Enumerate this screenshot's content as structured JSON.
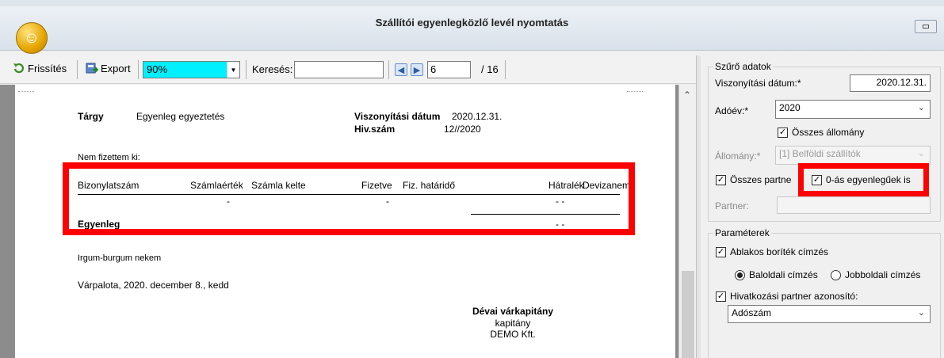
{
  "window": {
    "title": "Szállítói egyenlegközlő levél nyomtatás"
  },
  "toolbar": {
    "refresh_label": "Frissítés",
    "export_label": "Export",
    "zoom_value": "90%",
    "search_label": "Keresés:",
    "search_value": "",
    "page_value": "6",
    "page_total": "/ 16"
  },
  "report": {
    "subject_label": "Tárgy",
    "subject_value": "Egyenleg egyeztetés",
    "date_label": "Viszonyítási dátum",
    "date_value": "2020.12.31.",
    "ref_label": "Hiv.szám",
    "ref_value": "12//2020",
    "unpaid_text": "Nem fizettem ki:",
    "columns": [
      "Bizonylatszám",
      "Számlaérték",
      "Számla kelte",
      "Fizetve",
      "Fiz. határidő",
      "Hátralék",
      "Devizanem"
    ],
    "row_dash_1": "-",
    "row_dash_2": "-",
    "row_dash_3": "-  -",
    "balance_label": "Egyenleg",
    "balance_value": "-  -",
    "note": "Irgum-burgum nekem",
    "place_date": "Várpalota, 2020. december 8., kedd",
    "signer_name": "Dévai várkapitány",
    "signer_title": "kapitány",
    "signer_company": "DEMO Kft."
  },
  "filter": {
    "group_title": "Szűrő adatok",
    "ref_date_label": "Viszonyítási dátum:*",
    "ref_date_value": "2020.12.31.",
    "tax_year_label": "Adóév:*",
    "tax_year_value": "2020",
    "all_stock_label": "Összes állomány",
    "stock_label": "Állomány:*",
    "stock_value": "[1] Belföldi szállítók",
    "all_partner_label": "Összes partne",
    "zero_balance_label": "0-ás egyenlegűek is",
    "partner_label": "Partner:",
    "partner_value": ""
  },
  "params": {
    "group_title": "Paraméterek",
    "window_envelope_label": "Ablakos boríték címzés",
    "left_address_label": "Baloldali címzés",
    "right_address_label": "Jobboldali címzés",
    "ref_partner_id_label": "Hivatkozási partner azonosító:",
    "ref_partner_id_value": "Adószám"
  },
  "colors": {
    "highlight": "#ff0000",
    "zoom_bg": "#00f0ff",
    "app_icon": "#e6a400"
  }
}
